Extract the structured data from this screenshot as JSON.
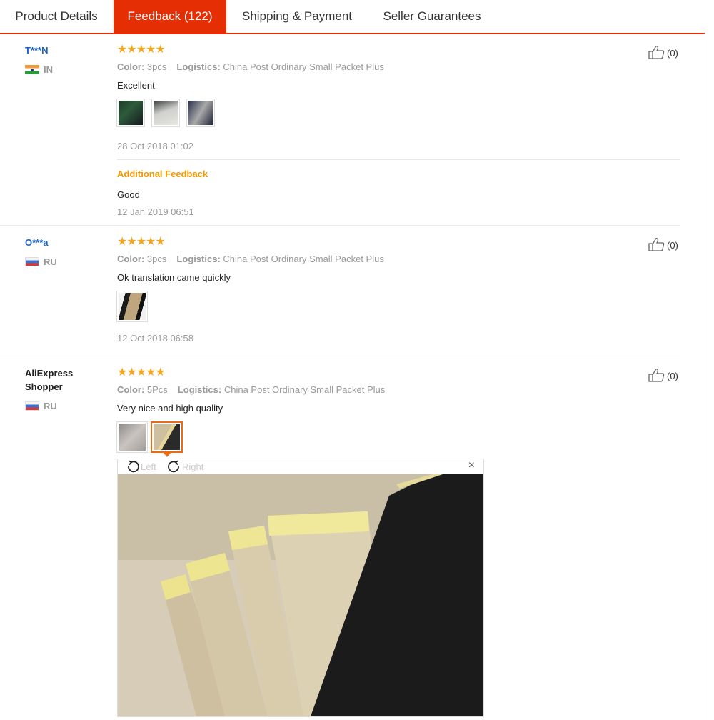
{
  "tabs": [
    {
      "label": "Product Details",
      "active": false
    },
    {
      "label": "Feedback (122)",
      "active": true
    },
    {
      "label": "Shipping & Payment",
      "active": false
    },
    {
      "label": "Seller Guarantees",
      "active": false
    }
  ],
  "feedback": [
    {
      "user": "T***N",
      "country": "IN",
      "rating": 5,
      "stars": "★★★★★",
      "color_label": "Color:",
      "color_value": "3pcs",
      "logistics_label": "Logistics:",
      "logistics_value": "China Post Ordinary Small Packet Plus",
      "text": "Excellent",
      "date": "28 Oct 2018 01:02",
      "additional_label": "Additional Feedback",
      "additional_text": "Good",
      "additional_date": "12 Jan 2019 06:51",
      "likes": "(0)"
    },
    {
      "user": "O***a",
      "country": "RU",
      "rating": 5,
      "stars": "★★★★★",
      "color_label": "Color:",
      "color_value": "3pcs",
      "logistics_label": "Logistics:",
      "logistics_value": "China Post Ordinary Small Packet Plus",
      "text": "Ok translation came quickly",
      "date": "12 Oct 2018 06:58",
      "likes": "(0)"
    },
    {
      "user": "AliExpress Shopper",
      "country": "RU",
      "rating": 5,
      "stars": "★★★★★",
      "color_label": "Color:",
      "color_value": "5Pcs",
      "logistics_label": "Logistics:",
      "logistics_value": "China Post Ordinary Small Packet Plus",
      "text": "Very nice and high quality",
      "likes": "(0)"
    }
  ],
  "viewer": {
    "rotate_left": "Left",
    "rotate_right": "Right",
    "close": "×"
  },
  "colors": {
    "accent": "#e62e04",
    "star": "#f5a623",
    "user_link": "#1a62c9",
    "additional": "#f39800",
    "selected_thumb": "#e76c1a"
  }
}
